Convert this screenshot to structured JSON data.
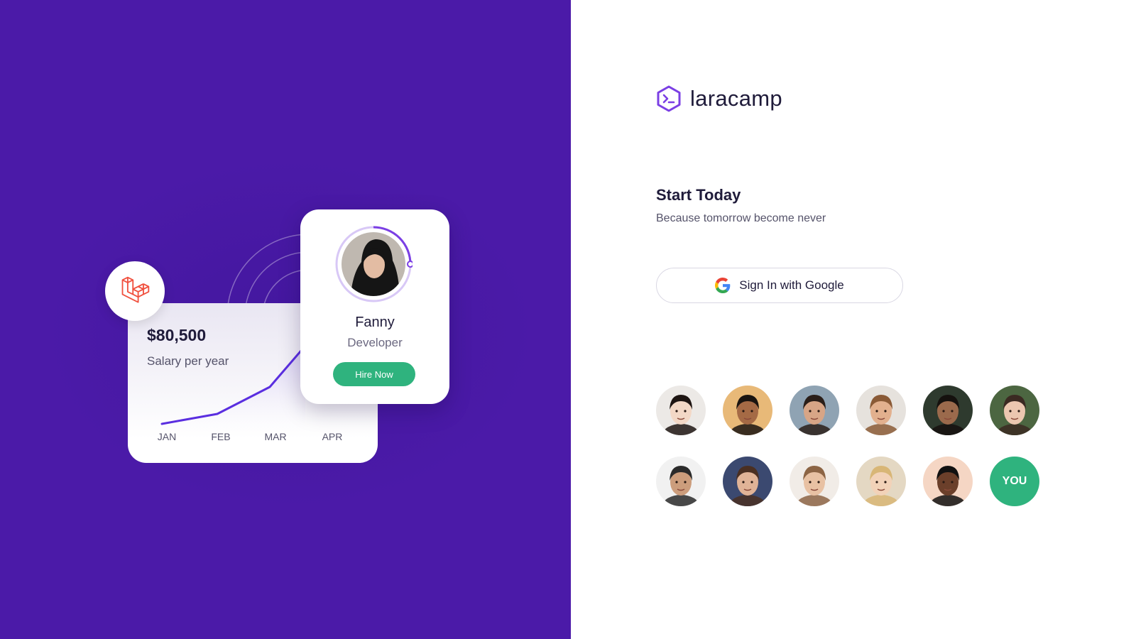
{
  "brand": {
    "name": "laracamp",
    "accent": "#7b3fe4"
  },
  "hero": {
    "background": "#4b1aa8",
    "salary_card": {
      "amount": "$80,500",
      "label": "Salary per year",
      "months": [
        "JAN",
        "FEB",
        "MAR",
        "APR"
      ]
    },
    "profile_card": {
      "name": "Fanny",
      "role": "Developer",
      "hire_label": "Hire Now",
      "hire_color": "#2fb37e"
    },
    "badge_icon": "laravel-logo-icon"
  },
  "main": {
    "heading": "Start Today",
    "subheading": "Because tomorrow become never",
    "google_button": {
      "label": "Sign In with Google",
      "icon": "google-g-icon"
    }
  },
  "community": {
    "avatars": [
      {
        "name": "avatar-1",
        "skin": "#f3d8c6",
        "hair": "#1e1512",
        "bg": "#ece9e6"
      },
      {
        "name": "avatar-2",
        "skin": "#a56a45",
        "hair": "#1a1410",
        "bg": "#e8b978"
      },
      {
        "name": "avatar-3",
        "skin": "#d7a586",
        "hair": "#2a1e18",
        "bg": "#8fa3b3"
      },
      {
        "name": "avatar-4",
        "skin": "#e2b08e",
        "hair": "#8a5a36",
        "bg": "#e6e2dd"
      },
      {
        "name": "avatar-5",
        "skin": "#9b6a4c",
        "hair": "#15110e",
        "bg": "#2e3a2e"
      },
      {
        "name": "avatar-6",
        "skin": "#ecc7b0",
        "hair": "#3b2a22",
        "bg": "#4c6641"
      },
      {
        "name": "avatar-7",
        "skin": "#cc9d7c",
        "hair": "#2a2a2a",
        "bg": "#f1f1f1"
      },
      {
        "name": "avatar-8",
        "skin": "#e0b397",
        "hair": "#4a2f22",
        "bg": "#3b4970"
      },
      {
        "name": "avatar-9",
        "skin": "#e8c1a3",
        "hair": "#8c6444",
        "bg": "#f1ece7"
      },
      {
        "name": "avatar-10",
        "skin": "#f2d2b8",
        "hair": "#d8b676",
        "bg": "#e4d8c3"
      },
      {
        "name": "avatar-11",
        "skin": "#6b3f2a",
        "hair": "#111111",
        "bg": "#f5d6c4"
      }
    ],
    "you_label": "YOU",
    "you_color": "#2fb37e"
  }
}
